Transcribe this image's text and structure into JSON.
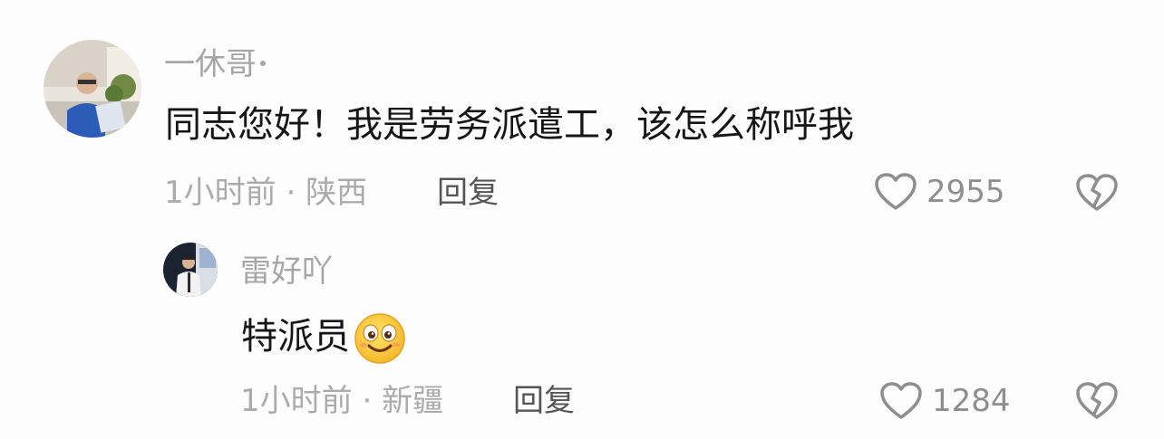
{
  "comments": [
    {
      "username": "一休哥",
      "text": "同志您好！我是劳务派遣工，该怎么称呼我",
      "time": "1小时前",
      "location": "陕西",
      "reply_label": "回复",
      "likes": "2955"
    },
    {
      "username": "雷好吖",
      "text": "特派员",
      "emoji": "smiling-face-emoji",
      "time": "1小时前",
      "location": "新疆",
      "reply_label": "回复",
      "likes": "1284"
    }
  ],
  "meta_separator": "·",
  "icons": {
    "like": "heart-outline-icon",
    "dislike": "broken-heart-icon"
  },
  "colors": {
    "username": "#a6a6a6",
    "text": "#161616",
    "meta": "#ababab",
    "reply": "#555555",
    "icon": "#8e8e8e"
  }
}
